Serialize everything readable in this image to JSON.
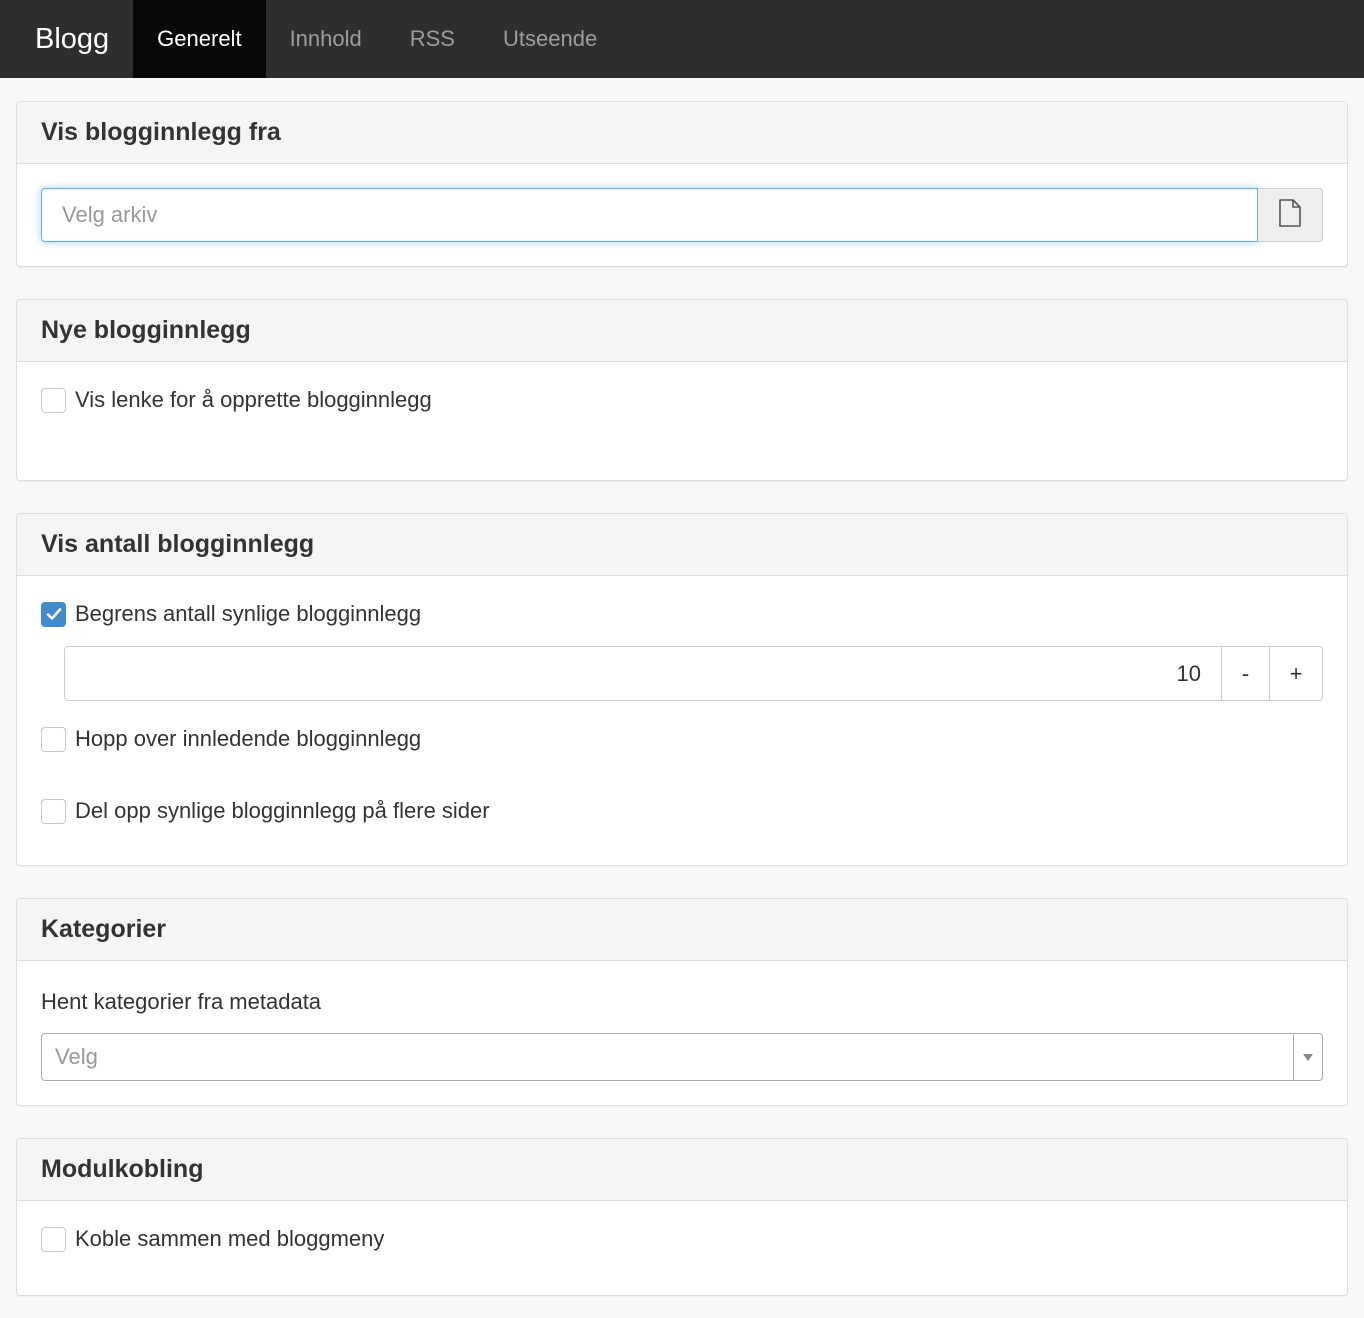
{
  "nav": {
    "brand": "Blogg",
    "tabs": [
      {
        "label": "Generelt",
        "active": true
      },
      {
        "label": "Innhold",
        "active": false
      },
      {
        "label": "RSS",
        "active": false
      },
      {
        "label": "Utseende",
        "active": false
      }
    ]
  },
  "panels": {
    "source": {
      "title": "Vis blogginnlegg fra",
      "archive_placeholder": "Velg arkiv",
      "browse_icon": "file-icon"
    },
    "new_posts": {
      "title": "Nye blogginnlegg",
      "show_create_link": {
        "label": "Vis lenke for å opprette blogginnlegg",
        "checked": false
      }
    },
    "count": {
      "title": "Vis antall blogginnlegg",
      "limit": {
        "label": "Begrens antall synlige blogginnlegg",
        "checked": true
      },
      "limit_value": "10",
      "minus_label": "-",
      "plus_label": "+",
      "skip_first": {
        "label": "Hopp over innledende blogginnlegg",
        "checked": false
      },
      "paginate": {
        "label": "Del opp synlige blogginnlegg på flere sider",
        "checked": false
      }
    },
    "categories": {
      "title": "Kategorier",
      "field_label": "Hent kategorier fra metadata",
      "select_placeholder": "Velg"
    },
    "module_link": {
      "title": "Modulkobling",
      "link_menu": {
        "label": "Koble sammen med bloggmeny",
        "checked": false
      }
    }
  },
  "colors": {
    "navbar": "#2e2e2e",
    "active_tab": "#080808",
    "checkbox_checked": "#428bca",
    "focus_border": "#66afe9"
  }
}
